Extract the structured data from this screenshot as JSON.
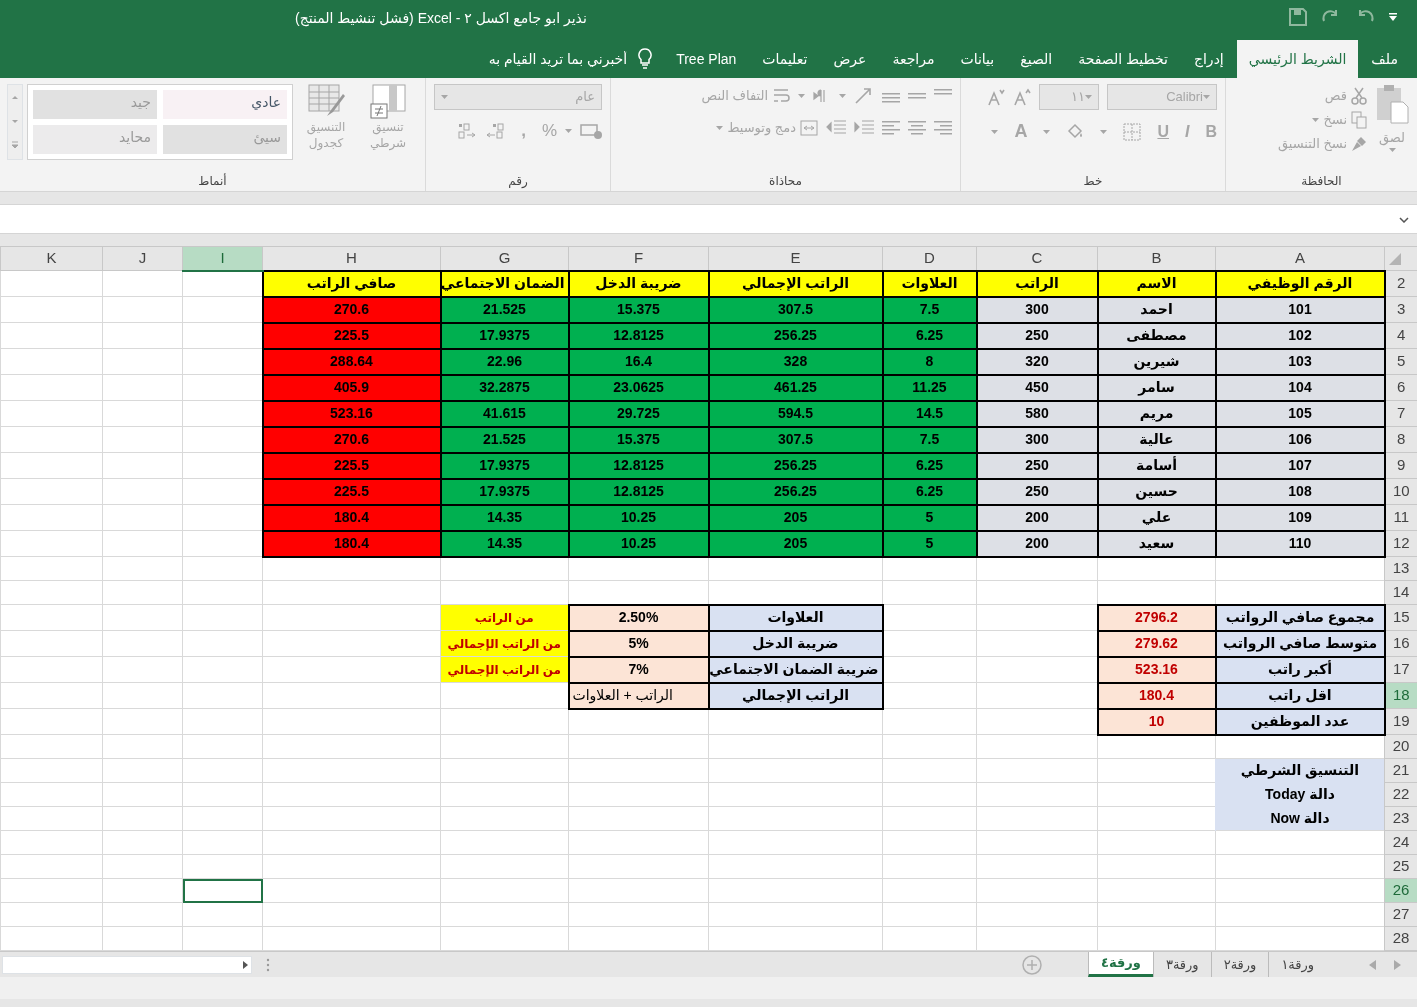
{
  "window": {
    "title": "نذير ابو جامع اكسل ٢  -  Excel (فشل تنشيط المنتج)"
  },
  "tabs": [
    {
      "label": "ملف",
      "selected": false
    },
    {
      "label": "الشريط الرئيسي",
      "selected": true
    },
    {
      "label": "إدراج",
      "selected": false
    },
    {
      "label": "تخطيط الصفحة",
      "selected": false
    },
    {
      "label": "الصيغ",
      "selected": false
    },
    {
      "label": "بيانات",
      "selected": false
    },
    {
      "label": "مراجعة",
      "selected": false
    },
    {
      "label": "عرض",
      "selected": false
    },
    {
      "label": "تعليمات",
      "selected": false
    },
    {
      "label": "Tree Plan",
      "selected": false
    }
  ],
  "tell_me": {
    "placeholder": "أخبرني بما تريد القيام به"
  },
  "ribbon": {
    "clipboard": {
      "label": "الحافظة",
      "paste": "لصق",
      "cut": "قص",
      "copy": "نسخ",
      "format_painter": "نسخ التنسيق"
    },
    "font": {
      "label": "خط",
      "font_name": "Calibri",
      "font_size": "١١",
      "bold": "B",
      "italic": "I",
      "underline": "U",
      "font_color": "A"
    },
    "alignment": {
      "label": "محاذاة",
      "wrap_text": "التفاف النص",
      "merge_center": "دمج وتوسيط"
    },
    "number": {
      "label": "رقم",
      "format": "عام",
      "percent": "%",
      "comma": ","
    },
    "styles": {
      "label": "أنماط",
      "conditional_formatting": "تنسيق شرطي",
      "format_as_table": "التنسيق كجدول",
      "cell_styles": [
        "عادي",
        "جيد",
        "سيئ",
        "محايد"
      ]
    }
  },
  "sheet": {
    "column_headers": [
      {
        "label": "A",
        "selected": false
      },
      {
        "label": "B",
        "selected": false
      },
      {
        "label": "C",
        "selected": false
      },
      {
        "label": "D",
        "selected": false
      },
      {
        "label": "E",
        "selected": false
      },
      {
        "label": "F",
        "selected": false
      },
      {
        "label": "G",
        "selected": false
      },
      {
        "label": "H",
        "selected": false
      },
      {
        "label": "I",
        "selected": true
      },
      {
        "label": "J",
        "selected": false
      },
      {
        "label": "K",
        "selected": false
      }
    ],
    "row_numbers": [
      {
        "label": "2",
        "selected": false
      },
      {
        "label": "3",
        "selected": false
      },
      {
        "label": "4",
        "selected": false
      },
      {
        "label": "5",
        "selected": false
      },
      {
        "label": "6",
        "selected": false
      },
      {
        "label": "7",
        "selected": false
      },
      {
        "label": "8",
        "selected": false
      },
      {
        "label": "9",
        "selected": false
      },
      {
        "label": "10",
        "selected": false
      },
      {
        "label": "11",
        "selected": false
      },
      {
        "label": "12",
        "selected": false
      },
      {
        "label": "13",
        "selected": false
      },
      {
        "label": "14",
        "selected": false
      },
      {
        "label": "15",
        "selected": false
      },
      {
        "label": "16",
        "selected": false
      },
      {
        "label": "17",
        "selected": false
      },
      {
        "label": "18",
        "selected": true
      },
      {
        "label": "19",
        "selected": false
      },
      {
        "label": "20",
        "selected": false
      },
      {
        "label": "21",
        "selected": false
      },
      {
        "label": "22",
        "selected": false
      },
      {
        "label": "23",
        "selected": false
      },
      {
        "label": "24",
        "selected": false
      },
      {
        "label": "25",
        "selected": false
      },
      {
        "label": "26",
        "selected": true
      },
      {
        "label": "27",
        "selected": false
      },
      {
        "label": "28",
        "selected": false
      }
    ],
    "salary_table": {
      "columns": [
        {
          "header": "الرقم الوظيفي",
          "color": "#dde0e6"
        },
        {
          "header": "الاسم",
          "color": "#dde0e6"
        },
        {
          "header": "الراتب",
          "color": "#dde0e6"
        },
        {
          "header": "العلاوات",
          "color": "#00b050"
        },
        {
          "header": "الراتب الإجمالي",
          "color": "#00b050"
        },
        {
          "header": "ضريبة الدخل",
          "color": "#00b050"
        },
        {
          "header": "الضمان الاجتماعي",
          "color": "#00b050"
        },
        {
          "header": "صافي الراتب",
          "color": "#ff0000"
        }
      ],
      "rows": [
        [
          "101",
          "احمد",
          "300",
          "7.5",
          "307.5",
          "15.375",
          "21.525",
          "270.6"
        ],
        [
          "102",
          "مصطفى",
          "250",
          "6.25",
          "256.25",
          "12.8125",
          "17.9375",
          "225.5"
        ],
        [
          "103",
          "شيرين",
          "320",
          "8",
          "328",
          "16.4",
          "22.96",
          "288.64"
        ],
        [
          "104",
          "سامر",
          "450",
          "11.25",
          "461.25",
          "23.0625",
          "32.2875",
          "405.9"
        ],
        [
          "105",
          "مريم",
          "580",
          "14.5",
          "594.5",
          "29.725",
          "41.615",
          "523.16"
        ],
        [
          "106",
          "عالية",
          "300",
          "7.5",
          "307.5",
          "15.375",
          "21.525",
          "270.6"
        ],
        [
          "107",
          "أسامة",
          "250",
          "6.25",
          "256.25",
          "12.8125",
          "17.9375",
          "225.5"
        ],
        [
          "108",
          "حسين",
          "250",
          "6.25",
          "256.25",
          "12.8125",
          "17.9375",
          "225.5"
        ],
        [
          "109",
          "علي",
          "200",
          "5",
          "205",
          "10.25",
          "14.35",
          "180.4"
        ],
        [
          "110",
          "سعيد",
          "200",
          "5",
          "205",
          "10.25",
          "14.35",
          "180.4"
        ]
      ]
    },
    "summary": [
      {
        "label": "مجموع صافي الرواتب",
        "value": "2796.2"
      },
      {
        "label": "متوسط صافي الرواتب",
        "value": "279.62"
      },
      {
        "label": "أكبر راتب",
        "value": "523.16"
      },
      {
        "label": "اقل راتب",
        "value": "180.4"
      },
      {
        "label": "عدد الموظفين",
        "value": "10"
      }
    ],
    "rates": [
      {
        "label": "العلاوات",
        "value": "2.50%",
        "note": "من الراتب",
        "kind": "number"
      },
      {
        "label": "ضريبة الدخل",
        "value": "5%",
        "note": "من الراتب الإجمالي",
        "kind": "number"
      },
      {
        "label": "ضريبة الضمان الاجتماعي",
        "value": "7%",
        "note": "من الراتب الإجمالي",
        "kind": "number"
      },
      {
        "label": "الراتب الإجمالي",
        "value": "الراتب + العلاوات",
        "kind": "text"
      }
    ],
    "notes": [
      "التنسيق الشرطي",
      "دالة Today",
      "دالة Now"
    ]
  },
  "sheet_tabs": [
    {
      "label": "ورقة١",
      "selected": false
    },
    {
      "label": "ورقة٢",
      "selected": false
    },
    {
      "label": "ورقة٣",
      "selected": false
    },
    {
      "label": "ورقة٤",
      "selected": true
    }
  ]
}
